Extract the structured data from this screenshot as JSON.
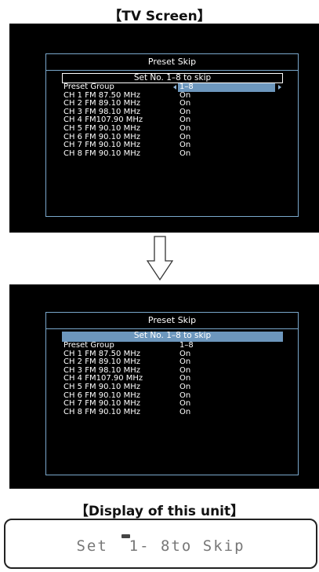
{
  "captions": {
    "tv_screen": "【TV Screen】",
    "display_unit": "【Display of this unit】"
  },
  "screen_before": {
    "title": "Preset Skip",
    "set_line": "Set No. 1–8 to skip",
    "group_label": "Preset Group",
    "group_value": "1–8",
    "rows": [
      {
        "label": "CH 1 FM  87.50 MHz",
        "value": "On"
      },
      {
        "label": "CH 2 FM  89.10 MHz",
        "value": "On"
      },
      {
        "label": "CH 3 FM  98.10 MHz",
        "value": "On"
      },
      {
        "label": "CH 4 FM107.90 MHz",
        "value": "On"
      },
      {
        "label": "CH 5 FM  90.10 MHz",
        "value": "On"
      },
      {
        "label": "CH 6 FM  90.10 MHz",
        "value": "On"
      },
      {
        "label": "CH 7 FM  90.10 MHz",
        "value": "On"
      },
      {
        "label": "CH 8 FM  90.10 MHz",
        "value": "On"
      }
    ]
  },
  "screen_after": {
    "title": "Preset Skip",
    "set_line": "Set No. 1–8 to skip",
    "group_label": "Preset Group",
    "group_value": "1–8",
    "rows": [
      {
        "label": "CH 1 FM  87.50 MHz",
        "value": "On"
      },
      {
        "label": "CH 2 FM  89.10 MHz",
        "value": "On"
      },
      {
        "label": "CH 3 FM  98.10 MHz",
        "value": "On"
      },
      {
        "label": "CH 4 FM107.90 MHz",
        "value": "On"
      },
      {
        "label": "CH 5 FM  90.10 MHz",
        "value": "On"
      },
      {
        "label": "CH 6 FM  90.10 MHz",
        "value": "On"
      },
      {
        "label": "CH 7 FM  90.10 MHz",
        "value": "On"
      },
      {
        "label": "CH 8 FM  90.10 MHz",
        "value": "On"
      }
    ]
  },
  "unit_display": {
    "text": "Set  1- 8to Skip"
  },
  "colors": {
    "screen_bg": "#000000",
    "panel_border": "#7aa8cc",
    "highlight": "#6d97bd",
    "text": "#ffffff"
  },
  "icons": {
    "transition": "down-arrow-outline-icon",
    "group_left": "triangle-left-icon",
    "group_right": "triangle-right-icon",
    "indicator": "preset-indicator-icon"
  }
}
